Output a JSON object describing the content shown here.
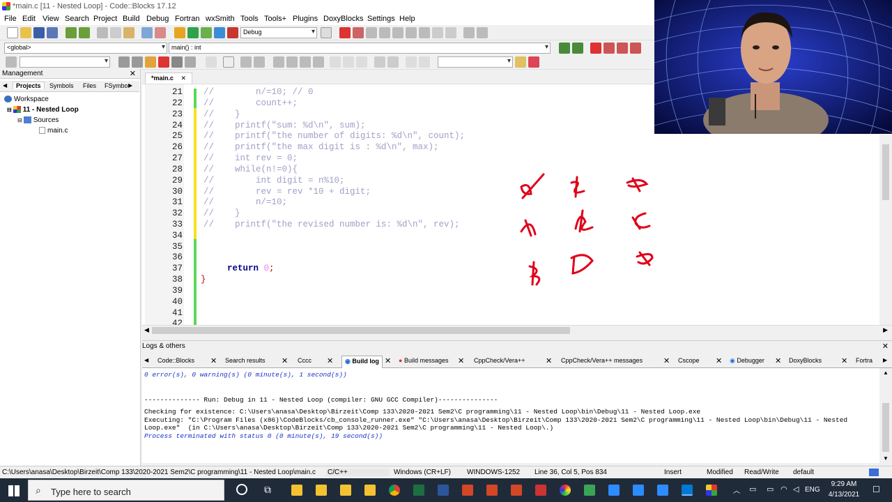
{
  "window": {
    "title": "*main.c [11 - Nested Loop] - Code::Blocks 17.12"
  },
  "menu": [
    "File",
    "Edit",
    "View",
    "Search",
    "Project",
    "Build",
    "Debug",
    "Fortran",
    "wxSmith",
    "Tools",
    "Tools+",
    "Plugins",
    "DoxyBlocks",
    "Settings",
    "Help"
  ],
  "toolbar": {
    "build_target": "Debug",
    "scope": "<global>",
    "function": "main() : int"
  },
  "management": {
    "title": "Management",
    "tabs": [
      "Projects",
      "Symbols",
      "Files",
      "FSymbo"
    ],
    "tree": [
      "Workspace",
      "11 - Nested Loop",
      "Sources",
      "main.c"
    ]
  },
  "editor": {
    "tab": "*main.c",
    "lines": [
      {
        "n": "21",
        "text": "//        n/=10; // 0"
      },
      {
        "n": "22",
        "text": "//        count++;"
      },
      {
        "n": "23",
        "text": "//    }"
      },
      {
        "n": "24",
        "text": "//    printf(\"sum: %d\\n\", sum);"
      },
      {
        "n": "25",
        "text": "//    printf(\"the number of digits: %d\\n\", count);"
      },
      {
        "n": "26",
        "text": "//    printf(\"the max digit is : %d\\n\", max);"
      },
      {
        "n": "27",
        "text": "//    int rev = 0;"
      },
      {
        "n": "28",
        "text": "//    while(n!=0){"
      },
      {
        "n": "29",
        "text": "//        int digit = n%10;"
      },
      {
        "n": "30",
        "text": "//        rev = rev *10 + digit;"
      },
      {
        "n": "31",
        "text": "//        n/=10;"
      },
      {
        "n": "32",
        "text": "//    }"
      },
      {
        "n": "33",
        "text": "//    printf(\"the revised number is: %d\\n\", rev);"
      },
      {
        "n": "34",
        "text": ""
      },
      {
        "n": "35",
        "text": ""
      },
      {
        "n": "36",
        "text": ""
      },
      {
        "n": "37",
        "keyword": "return",
        "number": "0",
        "punct": ";"
      },
      {
        "n": "38",
        "text": "}"
      },
      {
        "n": "39",
        "text": ""
      },
      {
        "n": "40",
        "text": ""
      },
      {
        "n": "41",
        "text": ""
      },
      {
        "n": "42",
        "text": ""
      }
    ]
  },
  "logs": {
    "title": "Logs & others",
    "tabs": [
      "Code::Blocks",
      "Search results",
      "Cccc",
      "Build log",
      "Build messages",
      "CppCheck/Vera++",
      "CppCheck/Vera++ messages",
      "Cscope",
      "Debugger",
      "DoxyBlocks",
      "Fortra"
    ],
    "active_tab": "Build log",
    "lines": [
      "0 error(s), 0 warning(s) (0 minute(s), 1 second(s))",
      "",
      "",
      "-------------- Run: Debug in 11 - Nested Loop (compiler: GNU GCC Compiler)---------------",
      "Checking for existence: C:\\Users\\anasa\\Desktop\\Birzeit\\Comp 133\\2020-2021 Sem2\\C programming\\11 - Nested Loop\\bin\\Debug\\11 - Nested Loop.exe",
      "Executing: \"C:\\Program Files (x86)\\CodeBlocks/cb_console_runner.exe\" \"C:\\Users\\anasa\\Desktop\\Birzeit\\Comp 133\\2020-2021 Sem2\\C programming\\11 - Nested Loop\\bin\\Debug\\11 - Nested",
      "Loop.exe\"  (in C:\\Users\\anasa\\Desktop\\Birzeit\\Comp 133\\2020-2021 Sem2\\C programming\\11 - Nested Loop\\.)",
      "Process terminated with status 0 (0 minute(s), 19 second(s))"
    ]
  },
  "status": {
    "path": "C:\\Users\\anasa\\Desktop\\Birzeit\\Comp 133\\2020-2021 Sem2\\C programming\\11 - Nested Loop\\main.c",
    "language": "C/C++",
    "eol": "Windows (CR+LF)",
    "encoding": "WINDOWS-1252",
    "position": "Line 36, Col 5, Pos 834",
    "mode": "Insert",
    "modified": "Modified",
    "access": "Read/Write",
    "profile": "default"
  },
  "taskbar": {
    "search_placeholder": "Type here to search",
    "lang": "ENG",
    "time": "9:29 AM",
    "date": "4/13/2021"
  },
  "colors": {
    "accent": "#1a32c8",
    "changebar": "#5bd75b",
    "handwriting": "#e0001a"
  }
}
